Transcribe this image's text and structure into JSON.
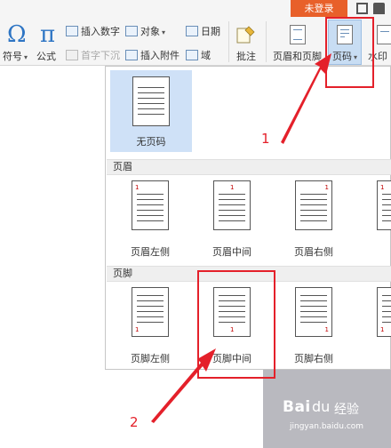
{
  "titlebar": {
    "login_label": "未登录"
  },
  "ribbon": {
    "symbol_glyph": "Ω",
    "symbol_label": "符号",
    "formula_glyph": "π",
    "formula_label": "公式",
    "insert_number_label": "插入数字",
    "object_label": "对象",
    "date_label": "日期",
    "drop_cap_label": "首字下沉",
    "insert_attachment_label": "插入附件",
    "field_label": "域",
    "comment_label": "批注",
    "header_footer_label": "页眉和页脚",
    "page_number_label": "页码",
    "watermark_label": "水印",
    "caret_glyph": "▾"
  },
  "dropdown": {
    "no_page_number_label": "无页码",
    "header_section_label": "页眉",
    "header_options": [
      "页眉左侧",
      "页眉中间",
      "页眉右侧",
      ""
    ],
    "footer_section_label": "页脚",
    "footer_options": [
      "页脚左侧",
      "页脚中间",
      "页脚右侧",
      ""
    ],
    "page_number_sample": "1"
  },
  "annotations": {
    "step1": "1",
    "step2": "2",
    "color": "#e4202a"
  },
  "watermark_brand": {
    "brand": "Bai",
    "paw": "du",
    "cn": "经验",
    "url": "jingyan.baidu.com"
  },
  "colors": {
    "accent": "#2e75c4",
    "login_button": "#e8602a",
    "selected_option": "#cfe1f7",
    "page_number_red": "#c00000"
  }
}
